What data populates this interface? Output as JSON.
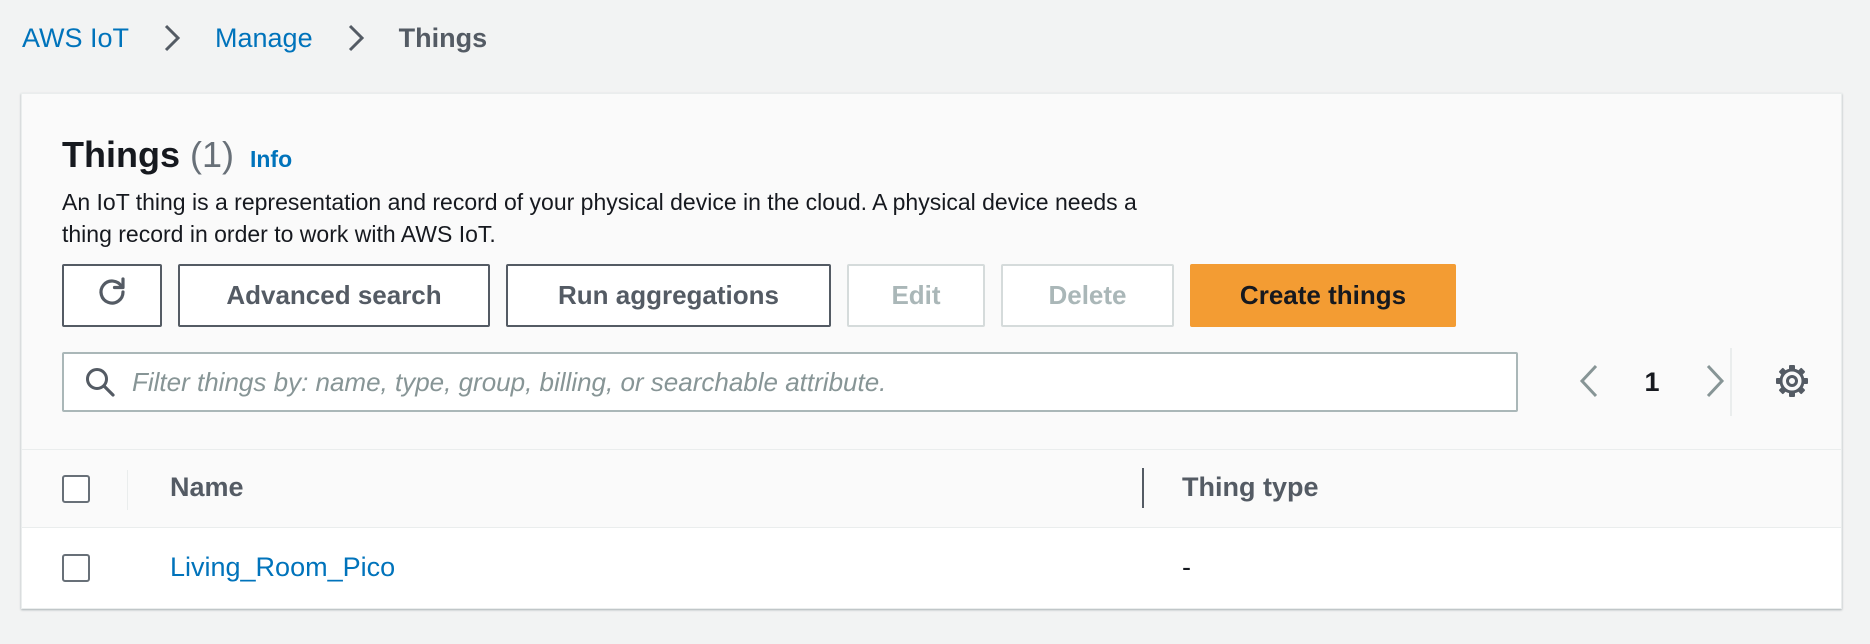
{
  "breadcrumb": {
    "items": [
      "AWS IoT",
      "Manage"
    ],
    "current": "Things"
  },
  "header": {
    "title": "Things",
    "count": "(1)",
    "info": "Info",
    "description": "An IoT thing is a representation and record of your physical device in the cloud. A physical device needs a thing record in order to work with AWS IoT."
  },
  "actions": {
    "advanced_search": "Advanced search",
    "run_aggregations": "Run aggregations",
    "edit": "Edit",
    "delete": "Delete",
    "create": "Create things"
  },
  "search": {
    "placeholder": "Filter things by: name, type, group, billing, or searchable attribute.",
    "value": ""
  },
  "pagination": {
    "current_page": "1"
  },
  "table": {
    "columns": [
      "Name",
      "Thing type"
    ],
    "rows": [
      {
        "name": "Living_Room_Pico",
        "thing_type": "-"
      }
    ]
  },
  "colors": {
    "link": "#0073bb",
    "primary_button": "#f39c33",
    "background": "#f2f3f3"
  },
  "icons": [
    "chevron-right-icon",
    "refresh-icon",
    "search-icon",
    "chevron-left-icon",
    "gear-icon"
  ]
}
